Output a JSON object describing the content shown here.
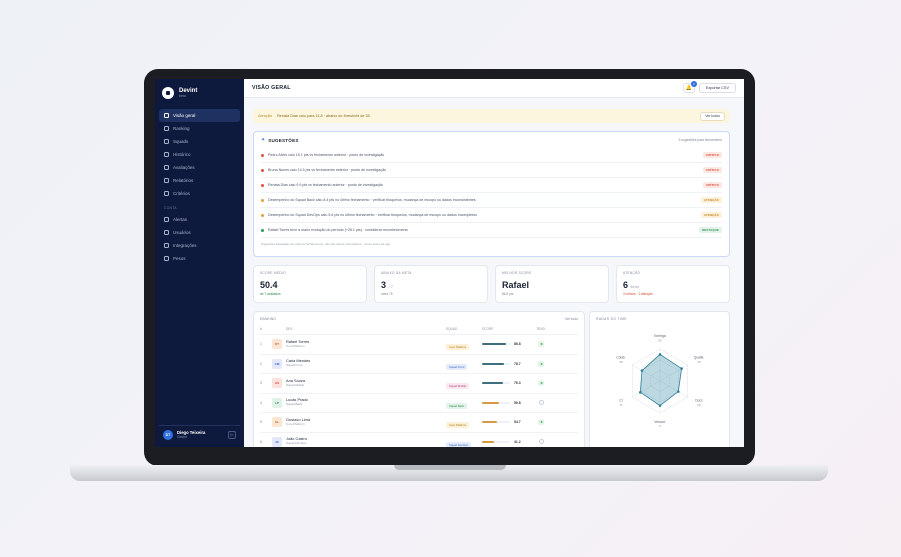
{
  "app": {
    "name": "Devint",
    "subtitle": "beta"
  },
  "sidebar": {
    "items": [
      {
        "label": "Visão geral",
        "active": true
      },
      {
        "label": "Ranking"
      },
      {
        "label": "Squads"
      },
      {
        "label": "Histórico"
      },
      {
        "label": "Avaliações"
      },
      {
        "label": "Relatórios"
      },
      {
        "label": "Critérios"
      }
    ],
    "section_label": "CONTA",
    "items2": [
      {
        "label": "Alertas"
      },
      {
        "label": "Usuários"
      },
      {
        "label": "Integrações"
      },
      {
        "label": "Pesos"
      }
    ],
    "user": {
      "initials": "DT",
      "name": "Diego Teixeira",
      "role": "Gestor"
    }
  },
  "header": {
    "title": "VISÃO GERAL",
    "notifications": "2",
    "export_label": "Exportar CSV"
  },
  "alert": {
    "tag": "Atenção",
    "text": "Renata Dias caiu para 11.8 · abaixo do threshold de 35",
    "button": "Ver todos"
  },
  "suggestions": {
    "title": "SUGESTÕES",
    "meta": "6 sugestões para fechamento",
    "rows": [
      {
        "text": "Pedro Alves caiu 15.1 pts vs fechamento anterior · ponto de investigação",
        "badge": "CRÍTICO",
        "dot": "#e0533d",
        "badge_bg": "#fde7e3",
        "badge_color": "#d0452f"
      },
      {
        "text": "Bruna Nunes caiu 14.3 pts vs fechamento anterior · ponto de investigação",
        "badge": "CRÍTICO",
        "dot": "#e0533d",
        "badge_bg": "#fde7e3",
        "badge_color": "#d0452f"
      },
      {
        "text": "Renata Dias caiu 9.9 pts vs fechamento anterior · ponto de investigação",
        "badge": "CRÍTICO",
        "dot": "#e0533d",
        "badge_bg": "#fde7e3",
        "badge_color": "#d0452f"
      },
      {
        "text": "Desempenho do Squad Back caiu 8.4 pts no último fechamento · verificar bloqueios, mudança de escopo ou dados inconsistentes",
        "badge": "ATENÇÃO",
        "dot": "#e2a23b",
        "badge_bg": "#fdf1db",
        "badge_color": "#c2831c"
      },
      {
        "text": "Desempenho do Squad DevOps caiu 5.6 pts no último fechamento · verificar bloqueios, mudança de escopo ou dados incompletos",
        "badge": "ATENÇÃO",
        "dot": "#e2a23b",
        "badge_bg": "#fdf1db",
        "badge_color": "#c2831c"
      },
      {
        "text": "Rafael Torres teve a maior evolução do período (+26.1 pts) · considerar reconhecimento",
        "badge": "DESTAQUE",
        "dot": "#2a9d5c",
        "badge_bg": "#e2f4e9",
        "badge_color": "#2a8a4d"
      }
    ],
    "footer": "Sugestões baseadas nos últimos fechamentos, não são ações automáticas · revise antes de agir."
  },
  "kpis": [
    {
      "label": "SCORE MÉDIO",
      "value": "50.4",
      "unit": "",
      "sub": "de 7 avaliados",
      "sub_color": "#2a8a4d"
    },
    {
      "label": "ABAIXO DA META",
      "value": "3",
      "unit": "/ 7",
      "sub": "meta 75",
      "sub_color": "#7f8799"
    },
    {
      "label": "MELHOR SCORE",
      "value": "Rafael",
      "unit": "",
      "sub": "86.8 pts",
      "sub_color": "#7f8799"
    },
    {
      "label": "ATENÇÃO",
      "value": "6",
      "unit": "itens",
      "sub": "3 críticos · 2 atenção",
      "sub_color": "#d0452f"
    }
  ],
  "ranking": {
    "title": "RANKING",
    "link": "Ver tudo",
    "columns": {
      "pos": "#",
      "dev": "DEV",
      "squad": "SQUAD",
      "score": "SCORE",
      "trend": "TEND."
    },
    "rows": [
      {
        "pos": "1",
        "initials": "RT",
        "name": "Rafael Torres",
        "team": "Core Platform",
        "squad": "Core Platform",
        "score": "86.8",
        "fill": 0.868,
        "trend": "↑8",
        "ava_bg": "#fbe6d4",
        "ava_color": "#c36a28",
        "chip_bg": "#fdf0d8",
        "chip_color": "#b57a15",
        "bar": "#3e6f7e"
      },
      {
        "pos": "2",
        "initials": "CM",
        "name": "Carla Mendes",
        "team": "Squad Front",
        "squad": "Squad Front",
        "score": "78.7",
        "fill": 0.787,
        "trend": "↑8",
        "ava_bg": "#e3e9fb",
        "ava_color": "#3a5fc7",
        "chip_bg": "#e4ecfb",
        "chip_color": "#3a5fc7",
        "bar": "#3e6f7e"
      },
      {
        "pos": "3",
        "initials": "AS",
        "name": "Ana Souza",
        "team": "Squad Mobile",
        "squad": "Squad Mobile",
        "score": "76.3",
        "fill": 0.763,
        "trend": "↑8",
        "ava_bg": "#fde1dd",
        "ava_color": "#c8473a",
        "chip_bg": "#f9e6ee",
        "chip_color": "#b8426f",
        "bar": "#3e6f7e"
      },
      {
        "pos": "4",
        "initials": "LP",
        "name": "Lucas Prado",
        "team": "Squad Back",
        "squad": "Squad Back",
        "score": "59.8",
        "fill": 0.598,
        "trend": "",
        "ava_bg": "#e0f2e7",
        "ava_color": "#2a8a4d",
        "chip_bg": "#e2f4e9",
        "chip_color": "#2a8a4d",
        "bar": "#d49a45"
      },
      {
        "pos": "5",
        "initials": "GL",
        "name": "Gustavo Lima",
        "team": "Core Platform",
        "squad": "Core Platform",
        "score": "54.7",
        "fill": 0.547,
        "trend": "↑8",
        "ava_bg": "#fbe6d4",
        "ava_color": "#c36a28",
        "chip_bg": "#fdf0d8",
        "chip_color": "#b57a15",
        "bar": "#d49a45"
      },
      {
        "pos": "6",
        "initials": "JC",
        "name": "João Castro",
        "team": "Squad DevOps",
        "squad": "Squad DevOps",
        "score": "41.2",
        "fill": 0.412,
        "trend": "",
        "ava_bg": "#e3e9fb",
        "ava_color": "#3a5fc7",
        "chip_bg": "#e4ecfb",
        "chip_color": "#3a5fc7",
        "bar": "#d49a45"
      }
    ]
  },
  "radar": {
    "title": "RADAR DO TIME",
    "axes": [
      {
        "label": "Entrega",
        "value": "83",
        "norm": 0.83
      },
      {
        "label": "Qualid.",
        "value": "78",
        "norm": 0.78
      },
      {
        "label": "Docs",
        "value": "66",
        "norm": 0.66
      },
      {
        "label": "Velocid.",
        "value": "77",
        "norm": 0.77
      },
      {
        "label": "CI",
        "value": "71",
        "norm": 0.71
      },
      {
        "label": "Colab.",
        "value": "65",
        "norm": 0.65
      }
    ]
  }
}
